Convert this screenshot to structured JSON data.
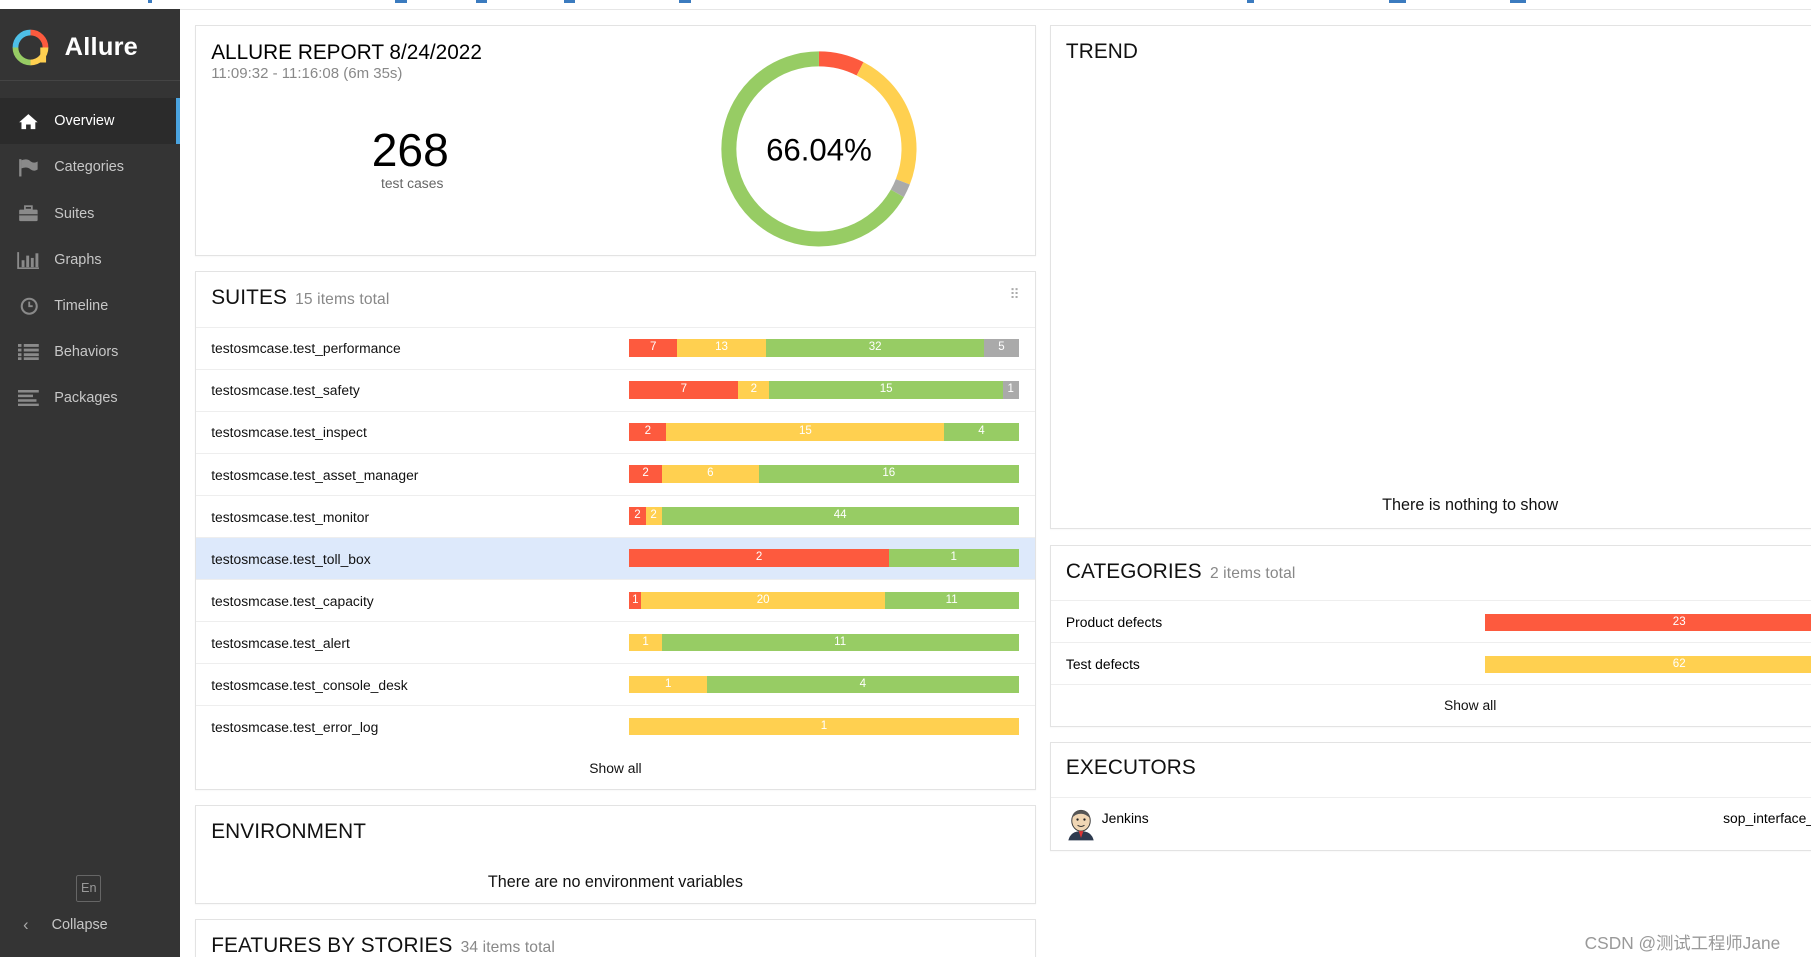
{
  "app": {
    "name": "Allure"
  },
  "nav": {
    "items": [
      {
        "label": "Overview",
        "icon": "home-icon",
        "active": true
      },
      {
        "label": "Categories",
        "icon": "flag-icon"
      },
      {
        "label": "Suites",
        "icon": "briefcase-icon"
      },
      {
        "label": "Graphs",
        "icon": "bar-chart-icon"
      },
      {
        "label": "Timeline",
        "icon": "clock-icon"
      },
      {
        "label": "Behaviors",
        "icon": "list-icon"
      },
      {
        "label": "Packages",
        "icon": "align-left-icon"
      }
    ],
    "language": "En",
    "collapse_label": "Collapse"
  },
  "summary": {
    "title": "ALLURE REPORT 8/24/2022",
    "time_range": "11:09:32 - 11:16:08 (6m 35s)",
    "count": "268",
    "count_label": "test cases",
    "percent": "66.04%",
    "donut": {
      "failed": 20,
      "broken": 62,
      "unknown": 6,
      "passed": 177
    }
  },
  "colors": {
    "failed": "#fd5a3e",
    "broken": "#ffd050",
    "passed": "#97cc64",
    "unknown": "#aaaaaa"
  },
  "suites": {
    "title": "SUITES",
    "subtitle": "15 items total",
    "show_all": "Show all",
    "items": [
      {
        "name": "testosmcase.test_performance",
        "failed": 7,
        "broken": 13,
        "passed": 32,
        "unknown": 5
      },
      {
        "name": "testosmcase.test_safety",
        "failed": 7,
        "broken": 2,
        "passed": 15,
        "unknown": 1
      },
      {
        "name": "testosmcase.test_inspect",
        "failed": 2,
        "broken": 15,
        "passed": 4,
        "unknown": 0
      },
      {
        "name": "testosmcase.test_asset_manager",
        "failed": 2,
        "broken": 6,
        "passed": 16,
        "unknown": 0
      },
      {
        "name": "testosmcase.test_monitor",
        "failed": 2,
        "broken": 2,
        "passed": 44,
        "unknown": 0
      },
      {
        "name": "testosmcase.test_toll_box",
        "failed": 2,
        "broken": 0,
        "passed": 1,
        "unknown": 0,
        "highlighted": true
      },
      {
        "name": "testosmcase.test_capacity",
        "failed": 1,
        "broken": 20,
        "passed": 11,
        "unknown": 0
      },
      {
        "name": "testosmcase.test_alert",
        "failed": 0,
        "broken": 1,
        "passed": 11,
        "unknown": 0
      },
      {
        "name": "testosmcase.test_console_desk",
        "failed": 0,
        "broken": 1,
        "passed": 4,
        "unknown": 0
      },
      {
        "name": "testosmcase.test_error_log",
        "failed": 0,
        "broken": 1,
        "passed": 0,
        "unknown": 0
      }
    ]
  },
  "environment": {
    "title": "ENVIRONMENT",
    "empty": "There are no environment variables"
  },
  "features": {
    "title": "FEATURES BY STORIES",
    "subtitle": "34 items total"
  },
  "trend": {
    "title": "TREND",
    "empty": "There is nothing to show"
  },
  "categories": {
    "title": "CATEGORIES",
    "subtitle": "2 items total",
    "show_all": "Show all",
    "items": [
      {
        "name": "Product defects",
        "value": "23",
        "status": "failed"
      },
      {
        "name": "Test defects",
        "value": "62",
        "status": "broken"
      }
    ]
  },
  "executors": {
    "title": "EXECUTORS",
    "name": "Jenkins",
    "build": "sop_interface_"
  },
  "watermark": "CSDN @测试工程师Jane"
}
